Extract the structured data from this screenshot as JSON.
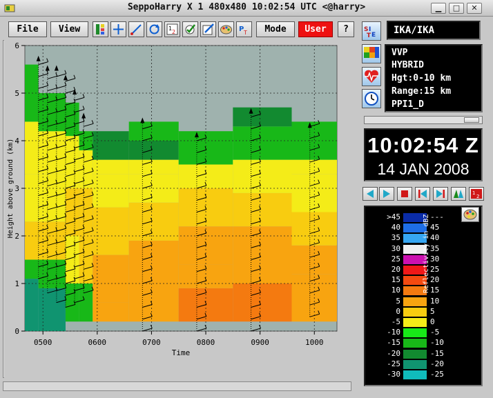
{
  "window": {
    "title": "SeppoHarry  X 1  480x480  10:02:54 UTC <@harry>",
    "buttons": [
      "minimize",
      "maximize",
      "close"
    ]
  },
  "toolbar": {
    "file_label": "File",
    "view_label": "View",
    "mode_label": "Mode",
    "user_label": "User",
    "help_label": "?",
    "icons": [
      "layers-icon",
      "crosshair-icon",
      "pen-icon",
      "rotate-icon",
      "numbers-icon",
      "check-icon",
      "edit-icon",
      "palette-tool-icon",
      "text-tool-icon"
    ]
  },
  "site": {
    "label": "IKA/IKA"
  },
  "product_info": {
    "lines": [
      "VVP",
      "HYBRID",
      "Hgt:0-10 km",
      "Range:15 km",
      "PPI1_D"
    ]
  },
  "clock": {
    "time": "10:02:54 Z",
    "date": "14 JAN 2008"
  },
  "animation_controls": [
    "play-back-icon",
    "play-forward-icon",
    "stop-icon",
    "skip-back-icon",
    "skip-forward-icon",
    "loop-icon",
    "swap-icon"
  ],
  "legend": {
    "title": "Reflectivity in dBZ",
    "left_labels": [
      ">45",
      "40",
      "35",
      "30",
      "25",
      "20",
      "15",
      "10",
      "5",
      "0",
      "-5",
      "-10",
      "-15",
      "-20",
      "-25",
      "-30"
    ],
    "right_labels": [
      "---",
      "45",
      "40",
      "35",
      "30",
      "25",
      "20",
      "15",
      "10",
      "5",
      "0",
      "-5",
      "-10",
      "-15",
      "-20",
      "-25"
    ],
    "colors": [
      "#0a2ca8",
      "#1e6ee6",
      "#36a6f2",
      "#f0f0f0",
      "#cc10b0",
      "#f01818",
      "#f44a10",
      "#f47a10",
      "#f8a410",
      "#f8cc10",
      "#f4ec18",
      "#18e818",
      "#18b818",
      "#128a30",
      "#109470",
      "#10bcbc"
    ]
  },
  "chart_data": {
    "type": "heatmap",
    "xlabel": "Time",
    "ylabel": "Height above ground (km)",
    "x_ticks": [
      "0500",
      "0600",
      "0700",
      "0800",
      "0900",
      "1000"
    ],
    "y_ticks": [
      "0",
      "1",
      "2",
      "3",
      "4",
      "5",
      "6"
    ],
    "xlim": [
      "04:40",
      "10:25"
    ],
    "ylim": [
      0,
      6
    ],
    "grid": true,
    "background_color": "#9fb2ae",
    "columns": [
      {
        "start": "04:40",
        "end": "04:55",
        "top_km": 5.6,
        "layers": [
          {
            "from": 0.0,
            "to": 1.1,
            "dbz": -20
          },
          {
            "from": 1.1,
            "to": 1.5,
            "dbz": -10
          },
          {
            "from": 1.5,
            "to": 2.3,
            "dbz": 5
          },
          {
            "from": 2.3,
            "to": 3.3,
            "dbz": 2
          },
          {
            "from": 3.3,
            "to": 4.4,
            "dbz": 0
          },
          {
            "from": 4.4,
            "to": 5.6,
            "dbz": -10
          }
        ]
      },
      {
        "start": "04:55",
        "end": "05:25",
        "top_km": 5.0,
        "layers": [
          {
            "from": 0.0,
            "to": 0.9,
            "dbz": -20
          },
          {
            "from": 0.9,
            "to": 1.5,
            "dbz": -10
          },
          {
            "from": 1.5,
            "to": 2.3,
            "dbz": 5
          },
          {
            "from": 2.3,
            "to": 3.3,
            "dbz": 2
          },
          {
            "from": 3.3,
            "to": 4.2,
            "dbz": 0
          },
          {
            "from": 4.2,
            "to": 5.0,
            "dbz": -10
          }
        ]
      },
      {
        "start": "05:25",
        "end": "05:40",
        "top_km": 4.8,
        "layers": [
          {
            "from": 0.2,
            "to": 1.0,
            "dbz": -10
          },
          {
            "from": 1.0,
            "to": 2.0,
            "dbz": 2
          },
          {
            "from": 2.0,
            "to": 3.0,
            "dbz": 3
          },
          {
            "from": 3.0,
            "to": 4.1,
            "dbz": 0
          },
          {
            "from": 4.1,
            "to": 4.8,
            "dbz": -10
          }
        ]
      },
      {
        "start": "05:40",
        "end": "05:55",
        "top_km": 4.2,
        "layers": [
          {
            "from": 0.2,
            "to": 1.0,
            "dbz": -10
          },
          {
            "from": 1.0,
            "to": 2.0,
            "dbz": 3
          },
          {
            "from": 2.0,
            "to": 3.0,
            "dbz": 3
          },
          {
            "from": 3.0,
            "to": 3.8,
            "dbz": 0
          },
          {
            "from": 3.8,
            "to": 4.2,
            "dbz": -10
          }
        ]
      },
      {
        "start": "05:55",
        "end": "06:35",
        "top_km": 4.2,
        "layers": [
          {
            "from": 0.2,
            "to": 0.6,
            "dbz": 10
          },
          {
            "from": 0.6,
            "to": 1.6,
            "dbz": 8
          },
          {
            "from": 1.6,
            "to": 2.6,
            "dbz": 5
          },
          {
            "from": 2.6,
            "to": 3.3,
            "dbz": 2
          },
          {
            "from": 3.3,
            "to": 3.6,
            "dbz": 0
          },
          {
            "from": 3.6,
            "to": 4.2,
            "dbz": -15
          }
        ]
      },
      {
        "start": "06:35",
        "end": "07:30",
        "top_km": 4.4,
        "layers": [
          {
            "from": 0.2,
            "to": 1.0,
            "dbz": 10
          },
          {
            "from": 1.0,
            "to": 1.9,
            "dbz": 8
          },
          {
            "from": 1.9,
            "to": 2.7,
            "dbz": 5
          },
          {
            "from": 2.7,
            "to": 3.3,
            "dbz": 2
          },
          {
            "from": 3.3,
            "to": 3.6,
            "dbz": 0
          },
          {
            "from": 3.6,
            "to": 4.0,
            "dbz": -15
          },
          {
            "from": 4.0,
            "to": 4.4,
            "dbz": -10
          }
        ]
      },
      {
        "start": "07:30",
        "end": "08:30",
        "top_km": 4.2,
        "layers": [
          {
            "from": 0.2,
            "to": 0.9,
            "dbz": 15
          },
          {
            "from": 0.9,
            "to": 1.4,
            "dbz": 10
          },
          {
            "from": 1.4,
            "to": 2.2,
            "dbz": 8
          },
          {
            "from": 2.2,
            "to": 3.0,
            "dbz": 5
          },
          {
            "from": 3.0,
            "to": 3.5,
            "dbz": 2
          },
          {
            "from": 3.5,
            "to": 4.2,
            "dbz": -10
          }
        ]
      },
      {
        "start": "08:30",
        "end": "09:35",
        "top_km": 4.7,
        "layers": [
          {
            "from": 0.2,
            "to": 1.0,
            "dbz": 15
          },
          {
            "from": 1.0,
            "to": 1.5,
            "dbz": 10
          },
          {
            "from": 1.5,
            "to": 2.2,
            "dbz": 8
          },
          {
            "from": 2.2,
            "to": 2.9,
            "dbz": 5
          },
          {
            "from": 2.9,
            "to": 3.6,
            "dbz": 2
          },
          {
            "from": 3.6,
            "to": 4.3,
            "dbz": -10
          },
          {
            "from": 4.3,
            "to": 4.7,
            "dbz": -15
          }
        ]
      },
      {
        "start": "09:35",
        "end": "10:25",
        "top_km": 4.4,
        "layers": [
          {
            "from": 0.2,
            "to": 1.2,
            "dbz": 10
          },
          {
            "from": 1.2,
            "to": 1.8,
            "dbz": 8
          },
          {
            "from": 1.8,
            "to": 2.5,
            "dbz": 5
          },
          {
            "from": 2.5,
            "to": 3.3,
            "dbz": 2
          },
          {
            "from": 3.3,
            "to": 3.6,
            "dbz": 0
          },
          {
            "from": 3.6,
            "to": 4.4,
            "dbz": -10
          }
        ]
      }
    ],
    "wind_profiles": [
      {
        "time": "04:55",
        "from_km": 1.1,
        "to_km": 5.7
      },
      {
        "time": "05:05",
        "from_km": 0.8,
        "to_km": 5.5
      },
      {
        "time": "05:15",
        "from_km": 0.6,
        "to_km": 5.5
      },
      {
        "time": "05:25",
        "from_km": 0.5,
        "to_km": 5.3
      },
      {
        "time": "05:35",
        "from_km": 0.6,
        "to_km": 5.0
      },
      {
        "time": "05:45",
        "from_km": 0.8,
        "to_km": 4.5
      },
      {
        "time": "06:50",
        "from_km": 0.0,
        "to_km": 4.4
      },
      {
        "time": "07:50",
        "from_km": 0.0,
        "to_km": 4.1
      },
      {
        "time": "08:50",
        "from_km": 0.0,
        "to_km": 4.6
      },
      {
        "time": "09:55",
        "from_km": 0.3,
        "to_km": 4.3
      }
    ]
  }
}
